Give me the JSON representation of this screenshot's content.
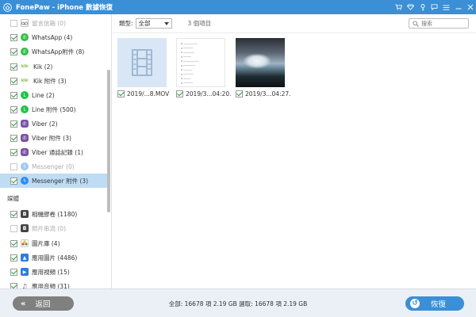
{
  "window": {
    "title": "FonePaw - iPhone 數據恢復",
    "controls": [
      "cart-icon",
      "diamond-icon",
      "key-icon",
      "chat-icon",
      "menu-icon",
      "minimize-icon",
      "close-icon"
    ]
  },
  "sidebar": {
    "items": [
      {
        "label": "留言信箱 (0)",
        "icon": "voicemail-icon",
        "checked": false,
        "dim": true
      },
      {
        "label": "WhatsApp (4)",
        "icon": "whatsapp-icon",
        "checked": true
      },
      {
        "label": "WhatsApp附件 (8)",
        "icon": "whatsapp-icon",
        "checked": true
      },
      {
        "label": "Kik (2)",
        "icon": "kik-icon",
        "checked": true
      },
      {
        "label": "Kik 附件 (3)",
        "icon": "kik-icon",
        "checked": true
      },
      {
        "label": "Line (2)",
        "icon": "line-icon",
        "checked": true
      },
      {
        "label": "Line 附件 (500)",
        "icon": "line-icon",
        "checked": true
      },
      {
        "label": "Viber (2)",
        "icon": "viber-icon",
        "checked": true
      },
      {
        "label": "Viber 附件 (3)",
        "icon": "viber-icon",
        "checked": true
      },
      {
        "label": "Viber 通話記錄 (1)",
        "icon": "viber-icon",
        "checked": true
      },
      {
        "label": "Messenger (0)",
        "icon": "messenger-icon",
        "checked": false,
        "dim": true
      },
      {
        "label": "Messenger 附件 (3)",
        "icon": "messenger-icon",
        "checked": true,
        "selected": true
      }
    ],
    "section_media": "媒體",
    "media_items": [
      {
        "label": "相機膠卷 (1180)",
        "icon": "camera-roll-icon",
        "checked": true
      },
      {
        "label": "照片串流 (0)",
        "icon": "photo-stream-icon",
        "checked": false,
        "dim": true
      },
      {
        "label": "圖片庫 (4)",
        "icon": "photo-library-icon",
        "checked": true
      },
      {
        "label": "應用圖片 (4486)",
        "icon": "app-photo-icon",
        "checked": true
      },
      {
        "label": "應用視頻 (15)",
        "icon": "app-video-icon",
        "checked": true
      },
      {
        "label": "應用音頻 (31)",
        "icon": "app-audio-icon",
        "checked": true
      }
    ]
  },
  "toolbar": {
    "type_label": "類型:",
    "type_value": "全部",
    "count_text": "3 個項目",
    "search_placeholder": "搜索"
  },
  "files": [
    {
      "name": "2019/...8.MOV",
      "kind": "video"
    },
    {
      "name": "2019/3...04:20.",
      "kind": "document"
    },
    {
      "name": "2019/3...04:27.",
      "kind": "photo"
    }
  ],
  "doc_preview_lines": 10,
  "bottom": {
    "back_label": "返回",
    "summary": "全部: 16678 項 2.19 GB 選取: 16678 項 2.19 GB",
    "recover_label": "恢復"
  },
  "colors": {
    "accent": "#3a8fd6",
    "selected_row": "#bedcf4",
    "check": "#2b9a3c",
    "back_button": "#808080"
  }
}
